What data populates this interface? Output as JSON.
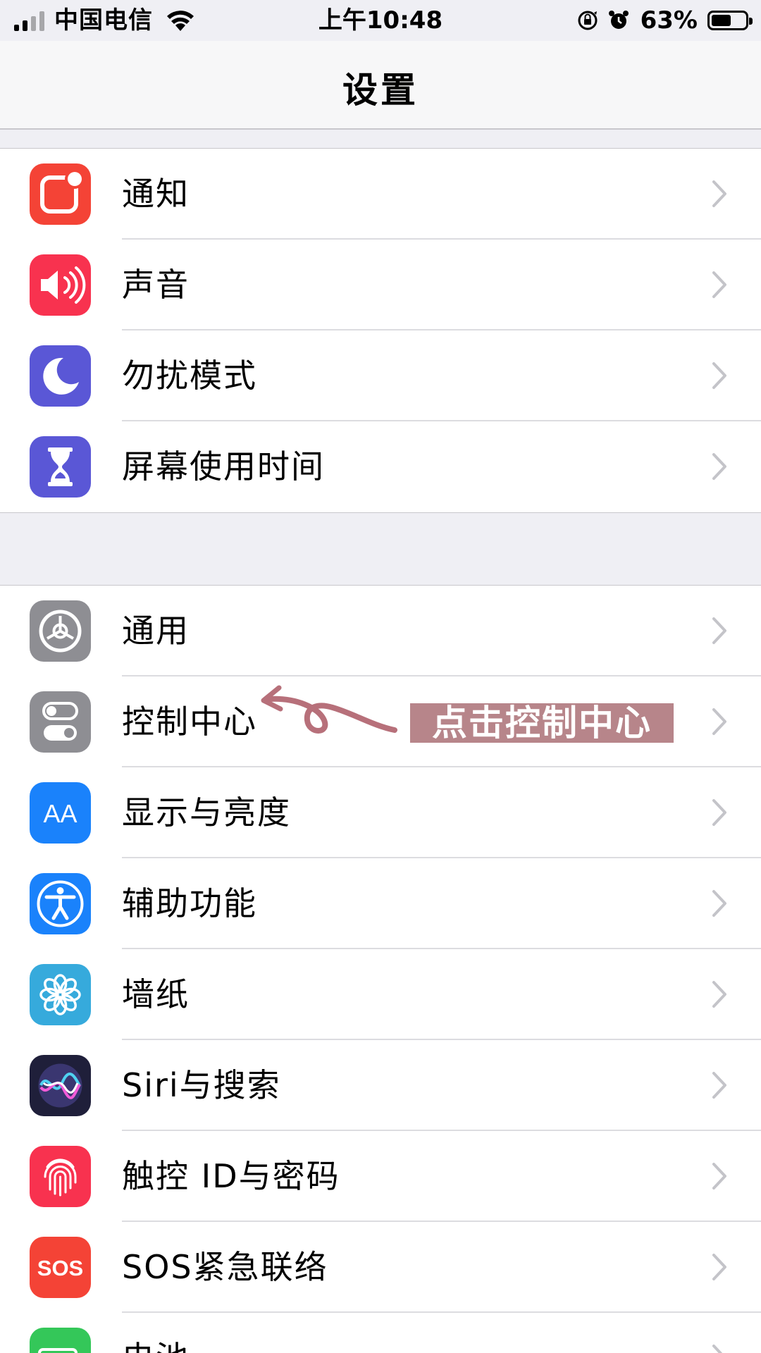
{
  "status_bar": {
    "carrier": "中国电信",
    "time": "上午10:48",
    "battery_percent": "63%",
    "battery_level": 0.63,
    "icons": [
      "signal-icon",
      "wifi-icon",
      "orientation-lock-icon",
      "alarm-icon",
      "battery-icon"
    ]
  },
  "nav": {
    "title": "设置"
  },
  "group1": {
    "items": [
      {
        "label": "通知",
        "icon": "notifications-icon",
        "color": "#f44336"
      },
      {
        "label": "声音",
        "icon": "sounds-icon",
        "color": "#f8324f"
      },
      {
        "label": "勿扰模式",
        "icon": "moon-icon",
        "color": "#5a57d6"
      },
      {
        "label": "屏幕使用时间",
        "icon": "hourglass-icon",
        "color": "#5a57d6"
      }
    ]
  },
  "group2": {
    "items": [
      {
        "label": "通用",
        "icon": "gear-icon",
        "color": "#8e8e93"
      },
      {
        "label": "控制中心",
        "icon": "toggles-icon",
        "color": "#8e8e93"
      },
      {
        "label": "显示与亮度",
        "icon": "display-aa-icon",
        "color": "#1a82fb"
      },
      {
        "label": "辅助功能",
        "icon": "accessibility-icon",
        "color": "#1a82fb"
      },
      {
        "label": "墙纸",
        "icon": "flower-icon",
        "color": "#36aadc"
      },
      {
        "label": "Siri与搜索",
        "icon": "siri-icon",
        "color": "#1f1f3a"
      },
      {
        "label": "触控 ID与密码",
        "icon": "fingerprint-icon",
        "color": "#f8324f"
      },
      {
        "label": "SOS紧急联络",
        "icon": "sos-icon",
        "color": "#f44336"
      },
      {
        "label": "电池",
        "icon": "battery-app-icon",
        "color": "#34c759"
      }
    ]
  },
  "annotation": {
    "text": "点击控制中心",
    "color": "#b7858a"
  }
}
